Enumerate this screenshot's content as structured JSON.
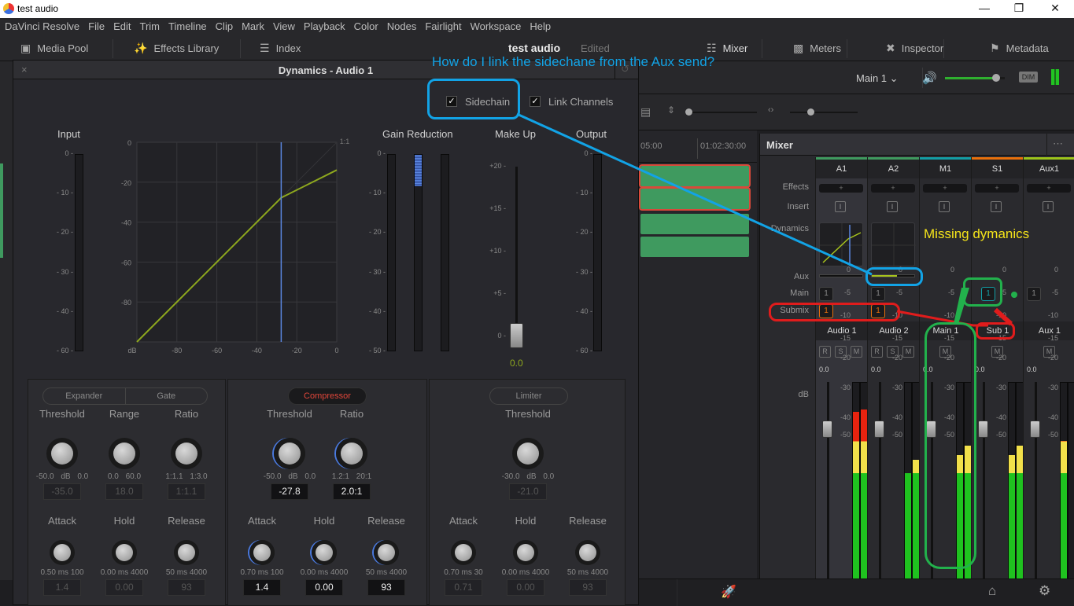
{
  "window": {
    "title": "test audio",
    "controls": [
      "minimize",
      "restore",
      "close"
    ]
  },
  "menu": [
    "DaVinci Resolve",
    "File",
    "Edit",
    "Trim",
    "Timeline",
    "Clip",
    "Mark",
    "View",
    "Playback",
    "Color",
    "Nodes",
    "Fairlight",
    "Workspace",
    "Help"
  ],
  "toolbar": {
    "left": [
      {
        "icon": "media-pool-icon",
        "label": "Media Pool"
      },
      {
        "icon": "effects-library-icon",
        "label": "Effects Library"
      },
      {
        "icon": "index-icon",
        "label": "Index"
      }
    ],
    "project_title": "test audio",
    "project_status": "Edited",
    "right": [
      {
        "icon": "mixer-icon",
        "label": "Mixer"
      },
      {
        "icon": "meters-icon",
        "label": "Meters"
      },
      {
        "icon": "inspector-icon",
        "label": "Inspector"
      },
      {
        "icon": "metadata-icon",
        "label": "Metadata"
      }
    ]
  },
  "monitor_bar": {
    "output": "Main 1",
    "volume_percent": 85,
    "dim_label": "DIM"
  },
  "timeline": {
    "timecodes": [
      "05:00",
      "01:02:30:00"
    ]
  },
  "dynamics": {
    "title": "Dynamics - Audio 1",
    "sidechain": {
      "label": "Sidechain",
      "checked": true
    },
    "link_channels": {
      "label": "Link Channels",
      "checked": true
    },
    "input": {
      "label": "Input",
      "ticks": [
        "0",
        "10",
        "20",
        "30",
        "40",
        "60"
      ]
    },
    "graph": {
      "y_ticks": [
        "0",
        "-20",
        "-40",
        "-60",
        "-80"
      ],
      "x_ticks": [
        "dB",
        "-80",
        "-60",
        "-40",
        "-20",
        "0"
      ],
      "ratio_label": "1:1",
      "threshold_db": -27.8,
      "ratio": 2.0
    },
    "gain_reduction": {
      "label": "Gain Reduction",
      "ticks": [
        "0",
        "10",
        "20",
        "30",
        "40",
        "50"
      ],
      "level_db": -8
    },
    "makeup": {
      "label": "Make Up",
      "ticks": [
        "+20",
        "+15",
        "+10",
        "+5",
        "0"
      ],
      "value": "0.0"
    },
    "output": {
      "label": "Output",
      "ticks": [
        "0",
        "10",
        "20",
        "30",
        "40",
        "60"
      ]
    },
    "expander": {
      "tabs": [
        "Expander",
        "Gate"
      ],
      "knobs_top": [
        {
          "label": "Threshold",
          "min": "-50.0 dB",
          "max": "0.0",
          "value": "-35.0"
        },
        {
          "label": "Range",
          "min": "0.0",
          "max": "60.0",
          "value": "18.0"
        },
        {
          "label": "Ratio",
          "min": "1:1.1",
          "max": "1:3.0",
          "value": "1:1.1"
        }
      ],
      "knobs_bottom": [
        {
          "label": "Attack",
          "min": "0.50",
          "unit": "ms",
          "max": "100",
          "value": "1.4"
        },
        {
          "label": "Hold",
          "min": "0.00",
          "unit": "ms",
          "max": "4000",
          "value": "0.00"
        },
        {
          "label": "Release",
          "min": "50",
          "unit": "ms",
          "max": "4000",
          "value": "93"
        }
      ]
    },
    "compressor": {
      "label": "Compressor",
      "active": true,
      "knobs_top": [
        {
          "label": "Threshold",
          "min": "-50.0 dB",
          "max": "0.0",
          "value": "-27.8"
        },
        {
          "label": "Ratio",
          "min": "1.2:1",
          "max": "20:1",
          "value": "2.0:1"
        }
      ],
      "knobs_bottom": [
        {
          "label": "Attack",
          "min": "0.70",
          "unit": "ms",
          "max": "100",
          "value": "1.4"
        },
        {
          "label": "Hold",
          "min": "0.00",
          "unit": "ms",
          "max": "4000",
          "value": "0.00"
        },
        {
          "label": "Release",
          "min": "50",
          "unit": "ms",
          "max": "4000",
          "value": "93"
        }
      ]
    },
    "limiter": {
      "label": "Limiter",
      "knobs_top": [
        {
          "label": "Threshold",
          "min": "-30.0 dB",
          "max": "0.0",
          "value": "-21.0"
        }
      ],
      "knobs_bottom": [
        {
          "label": "Attack",
          "min": "0.70",
          "unit": "ms",
          "max": "30",
          "value": "0.71"
        },
        {
          "label": "Hold",
          "min": "0.00",
          "unit": "ms",
          "max": "4000",
          "value": "0.00"
        },
        {
          "label": "Release",
          "min": "50",
          "unit": "ms",
          "max": "4000",
          "value": "93"
        }
      ]
    }
  },
  "mixer": {
    "title": "Mixer",
    "row_labels": {
      "effects": "Effects",
      "insert": "Insert",
      "dynamics": "Dynamics",
      "aux": "Aux",
      "main": "Main",
      "submix": "Submix",
      "db": "dB"
    },
    "channels": [
      {
        "id": "A1",
        "name": "Audio 1",
        "color": "#3f9a5f",
        "insert": "I",
        "main": "1",
        "submix": "1",
        "buttons": [
          "R",
          "S",
          "M"
        ],
        "gain": "0.0",
        "meter_l": -1.5,
        "meter_r": -1.0
      },
      {
        "id": "A2",
        "name": "Audio 2",
        "color": "#3f9a5f",
        "insert": "I",
        "main": "1",
        "submix": "1",
        "buttons": [
          "R",
          "S",
          "M"
        ],
        "gain": "0.0",
        "meter_l": -15,
        "meter_r": -12
      },
      {
        "id": "M1",
        "name": "Main 1",
        "color": "#139ea5",
        "insert": "I",
        "buttons": [
          "M"
        ],
        "gain": "0.0",
        "meter_l": -11,
        "meter_r": -9
      },
      {
        "id": "S1",
        "name": "Sub 1",
        "color": "#e8700c",
        "insert": "I",
        "main": "1",
        "buttons": [
          "M"
        ],
        "gain": "0.0",
        "meter_l": -11,
        "meter_r": -9
      },
      {
        "id": "Aux1",
        "name": "Aux 1",
        "color": "#9cc41c",
        "insert": "I",
        "main": "1",
        "buttons": [
          "M"
        ],
        "gain": "0.0",
        "meter_l": -8,
        "meter_r": -60
      }
    ],
    "meter_ticks": [
      "0",
      "-5",
      "-10",
      "-15",
      "-20",
      "-30",
      "-40",
      "-50"
    ]
  },
  "annotations": {
    "question": "How do I link the sidechane from the Aux send?",
    "missing": "Missing dymanics"
  }
}
